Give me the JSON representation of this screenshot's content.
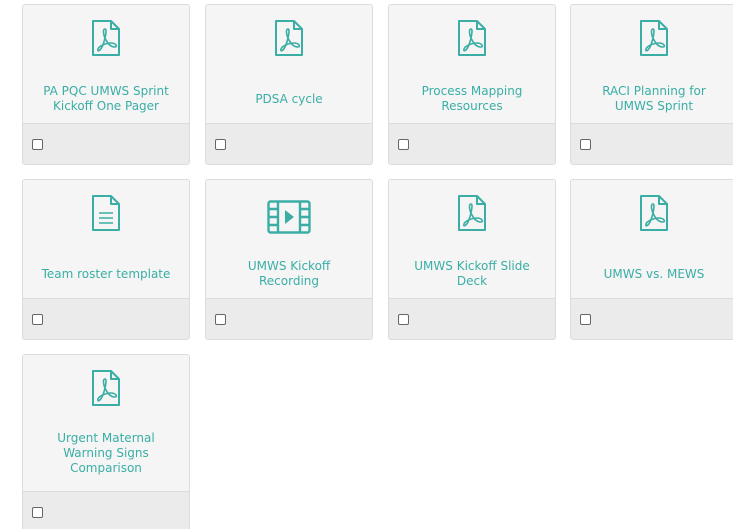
{
  "accent_color": "#3aaea5",
  "cards": [
    {
      "title": "PA PQC UMWS Sprint Kickoff One Pager",
      "icon": "pdf-icon"
    },
    {
      "title": "PDSA cycle",
      "icon": "pdf-icon"
    },
    {
      "title": "Process Mapping Resources",
      "icon": "pdf-icon"
    },
    {
      "title": "RACI Planning for UMWS Sprint",
      "icon": "pdf-icon"
    },
    {
      "title": "Team roster template",
      "icon": "document-icon"
    },
    {
      "title": "UMWS Kickoff Recording",
      "icon": "video-icon"
    },
    {
      "title": "UMWS Kickoff Slide Deck",
      "icon": "pdf-icon"
    },
    {
      "title": "UMWS vs. MEWS",
      "icon": "pdf-icon"
    },
    {
      "title": "Urgent Maternal Warning Signs Comparison",
      "icon": "pdf-icon"
    }
  ]
}
